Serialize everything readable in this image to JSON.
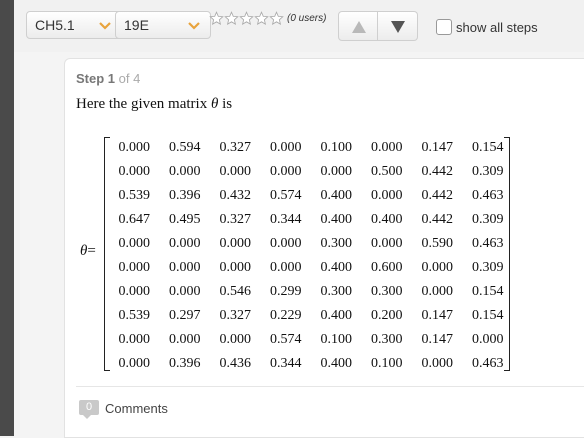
{
  "toolbar": {
    "chapter_select": {
      "value": "CH5.1"
    },
    "problem_select": {
      "value": "19E"
    },
    "rating": {
      "stars": 5,
      "filled": 0,
      "users_text": "(0 users)"
    },
    "nav": {
      "up_icon": "triangle-up-icon",
      "down_icon": "triangle-down-icon"
    },
    "show_all_steps": {
      "label": "show all steps",
      "checked": false
    }
  },
  "step": {
    "title": "Step 1",
    "of": "of 4",
    "intro_prefix": "Here the given matrix",
    "intro_symbol": "θ",
    "intro_suffix": "is",
    "equation_symbol": "θ",
    "equation_equals": "=",
    "matrix": [
      [
        "0.000",
        "0.594",
        "0.327",
        "0.000",
        "0.100",
        "0.000",
        "0.147",
        "0.154"
      ],
      [
        "0.000",
        "0.000",
        "0.000",
        "0.000",
        "0.000",
        "0.500",
        "0.442",
        "0.309"
      ],
      [
        "0.539",
        "0.396",
        "0.432",
        "0.574",
        "0.400",
        "0.000",
        "0.442",
        "0.463"
      ],
      [
        "0.647",
        "0.495",
        "0.327",
        "0.344",
        "0.400",
        "0.400",
        "0.442",
        "0.309"
      ],
      [
        "0.000",
        "0.000",
        "0.000",
        "0.000",
        "0.300",
        "0.000",
        "0.590",
        "0.463"
      ],
      [
        "0.000",
        "0.000",
        "0.000",
        "0.000",
        "0.400",
        "0.600",
        "0.000",
        "0.309"
      ],
      [
        "0.000",
        "0.000",
        "0.546",
        "0.299",
        "0.300",
        "0.300",
        "0.000",
        "0.154"
      ],
      [
        "0.539",
        "0.297",
        "0.327",
        "0.229",
        "0.400",
        "0.200",
        "0.147",
        "0.154"
      ],
      [
        "0.000",
        "0.000",
        "0.000",
        "0.574",
        "0.100",
        "0.300",
        "0.147",
        "0.000"
      ],
      [
        "0.000",
        "0.396",
        "0.436",
        "0.344",
        "0.400",
        "0.100",
        "0.000",
        "0.463"
      ]
    ]
  },
  "comments": {
    "count": "0",
    "label": "Comments"
  },
  "colors": {
    "accent_chevron": "#e8a33c",
    "sidebar": "#4a4a4a"
  }
}
